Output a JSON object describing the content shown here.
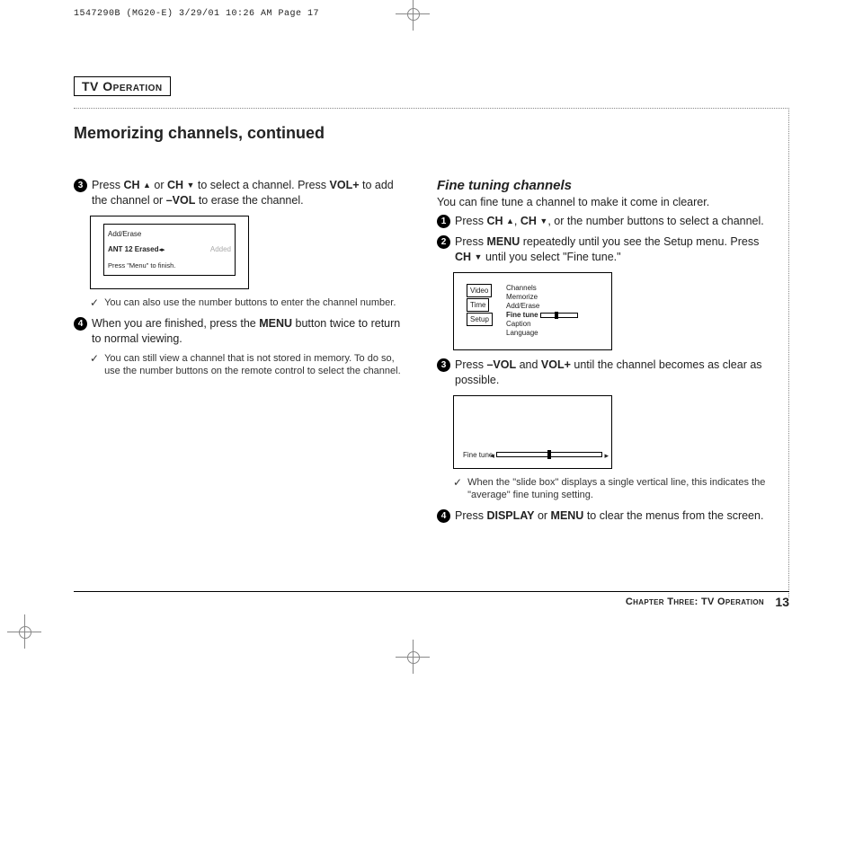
{
  "meta": {
    "headerLine": "1547290B (MG20-E)  3/29/01 10:26 AM  Page 17"
  },
  "section": "TV Operation",
  "title": "Memorizing channels, continued",
  "left": {
    "step3": {
      "num": "3",
      "t1": "Press ",
      "t2": "CH",
      "t3": " or ",
      "t4": "CH",
      "t5": " to select a channel. Press ",
      "t6": "VOL+",
      "t7": " to add the channel or ",
      "t8": "–VOL",
      "t9": " to erase the channel."
    },
    "osd1": {
      "line1": "Add/Erase",
      "line2a": "ANT 12  Erased",
      "line2b": "Added",
      "line3": "Press \"Menu\" to finish."
    },
    "tip1": "You can also use the number buttons to enter the channel number.",
    "step4": {
      "num": "4",
      "t1": "When you are finished, press the ",
      "t2": "MENU",
      "t3": " button twice to return to normal viewing."
    },
    "tip2": "You can still view a channel that is not stored in memory. To do so, use the number buttons on the remote control to select the channel."
  },
  "right": {
    "subhead": "Fine tuning channels",
    "intro": "You can fine tune a channel to make it come in clearer.",
    "step1": {
      "num": "1",
      "t1": "Press ",
      "t2": "CH",
      "t3": ", ",
      "t4": "CH",
      "t5": ", or the number buttons to select a channel."
    },
    "step2": {
      "num": "2",
      "t1": "Press ",
      "t2": "MENU",
      "t3": " repeatedly until you see the Setup menu. Press ",
      "t4": "CH",
      "t5": " until you select \"Fine tune.\""
    },
    "osd2": {
      "leftTabs": [
        "Video",
        "Time",
        "Setup"
      ],
      "items": [
        "Channels",
        "Memorize",
        "Add/Erase",
        "Fine tune",
        "Caption",
        "Language"
      ]
    },
    "step3": {
      "num": "3",
      "t1": "Press ",
      "t2": "–VOL",
      "t3": " and ",
      "t4": "VOL+",
      "t5": " until the channel becomes as clear as possible."
    },
    "osd3Label": "Fine tune",
    "tip1": "When the \"slide box\" displays a single vertical line, this indicates the \"average\" fine tuning setting.",
    "step4": {
      "num": "4",
      "t1": "Press ",
      "t2": "DISPLAY",
      "t3": " or ",
      "t4": "MENU",
      "t5": " to clear the menus from the screen."
    }
  },
  "footer": {
    "label": "Chapter Three: TV Operation",
    "page": "13"
  }
}
